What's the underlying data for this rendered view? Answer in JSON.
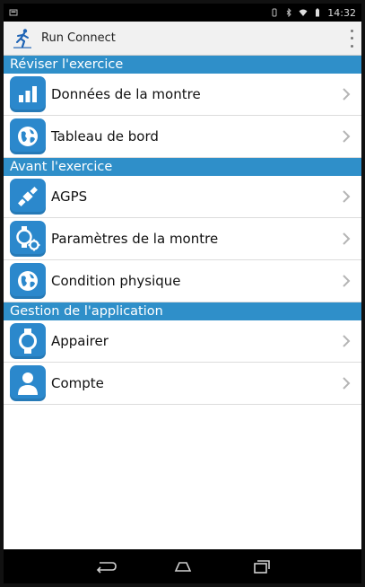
{
  "status": {
    "time": "14:32"
  },
  "app": {
    "title": "Run Connect"
  },
  "sections": [
    {
      "title": "Réviser l'exercice",
      "items": [
        {
          "label": "Données de la montre",
          "icon": "bar-chart-icon"
        },
        {
          "label": "Tableau de bord",
          "icon": "globe-icon"
        }
      ]
    },
    {
      "title": "Avant l'exercice",
      "items": [
        {
          "label": "AGPS",
          "icon": "satellite-icon"
        },
        {
          "label": "Paramètres de la montre",
          "icon": "watch-settings-icon"
        },
        {
          "label": "Condition physique",
          "icon": "globe-icon"
        }
      ]
    },
    {
      "title": "Gestion de l'application",
      "items": [
        {
          "label": "Appairer",
          "icon": "watch-icon"
        },
        {
          "label": "Compte",
          "icon": "person-icon"
        }
      ]
    }
  ],
  "colors": {
    "section": "#2f8fc9",
    "tile": "#2b88cc"
  }
}
